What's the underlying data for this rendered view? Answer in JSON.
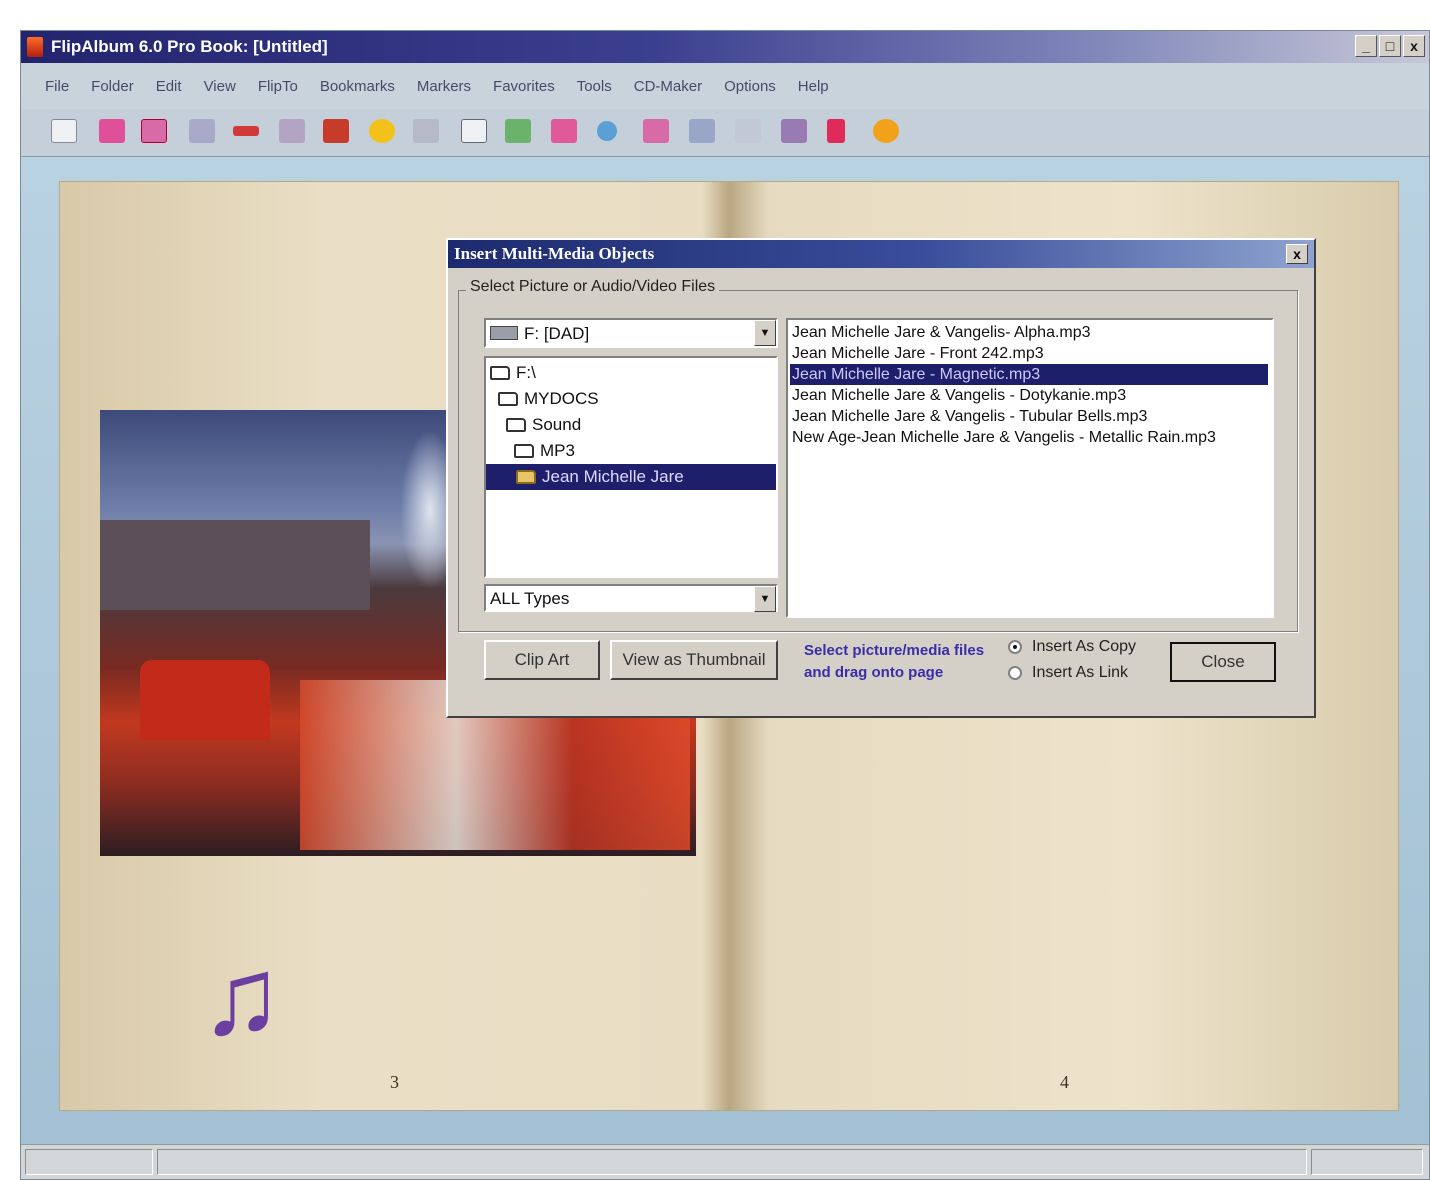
{
  "window": {
    "title": "FlipAlbum 6.0 Pro    Book: [Untitled]",
    "controls": {
      "minimize": "_",
      "maximize": "□",
      "close": "x"
    }
  },
  "menu": [
    "File",
    "Folder",
    "Edit",
    "View",
    "FlipTo",
    "Bookmarks",
    "Markers",
    "Favorites",
    "Tools",
    "CD-Maker",
    "Options",
    "Help"
  ],
  "toolbar": {
    "icons": [
      "book-icon",
      "pink-album-icon",
      "open-book-icon",
      "thumbnails-icon",
      "next-arrow-icon",
      "edit-icon",
      "save-icon",
      "plus-icon",
      "zoom-icon",
      "columns-icon",
      "tree-icon",
      "photos-icon",
      "refresh-icon",
      "pages-icon",
      "print-icon",
      "monitor-icon",
      "copy-icon",
      "play-icon",
      "cd-icon"
    ]
  },
  "book": {
    "left_page_number": "3",
    "right_page_number": "4",
    "music_symbol": "♫"
  },
  "dialog": {
    "title": "Insert Multi-Media Objects",
    "close": "x",
    "group_label": "Select Picture or Audio/Video Files",
    "drive": "F: [DAD]",
    "folders": [
      "F:\\",
      "MYDOCS",
      "Sound",
      "MP3",
      "Jean Michelle Jare"
    ],
    "selected_folder": "Jean Michelle Jare",
    "file_types": "ALL Types",
    "files": [
      "Jean Michelle Jare  & Vangelis- Alpha.mp3",
      "Jean Michelle Jare - Front 242.mp3",
      "Jean Michelle Jare - Magnetic.mp3",
      "Jean Michelle Jare & Vangelis - Dotykanie.mp3",
      "Jean Michelle Jare & Vangelis - Tubular Bells.mp3",
      "New Age-Jean Michelle Jare & Vangelis - Metallic Rain.mp3"
    ],
    "selected_file_index": 2,
    "buttons": {
      "clip_art": "Clip Art",
      "view_thumbnail": "View as Thumbnail",
      "close": "Close"
    },
    "hint": "Select picture/media files and drag onto page",
    "insert_options": [
      {
        "label": "Insert As Copy",
        "checked": true
      },
      {
        "label": "Insert As Link",
        "checked": false
      }
    ]
  },
  "colors": {
    "title_bar": "#23246e",
    "selection": "#1d1f6a",
    "hint_text": "#3a2ea8",
    "music_note": "#6a3fa0"
  }
}
